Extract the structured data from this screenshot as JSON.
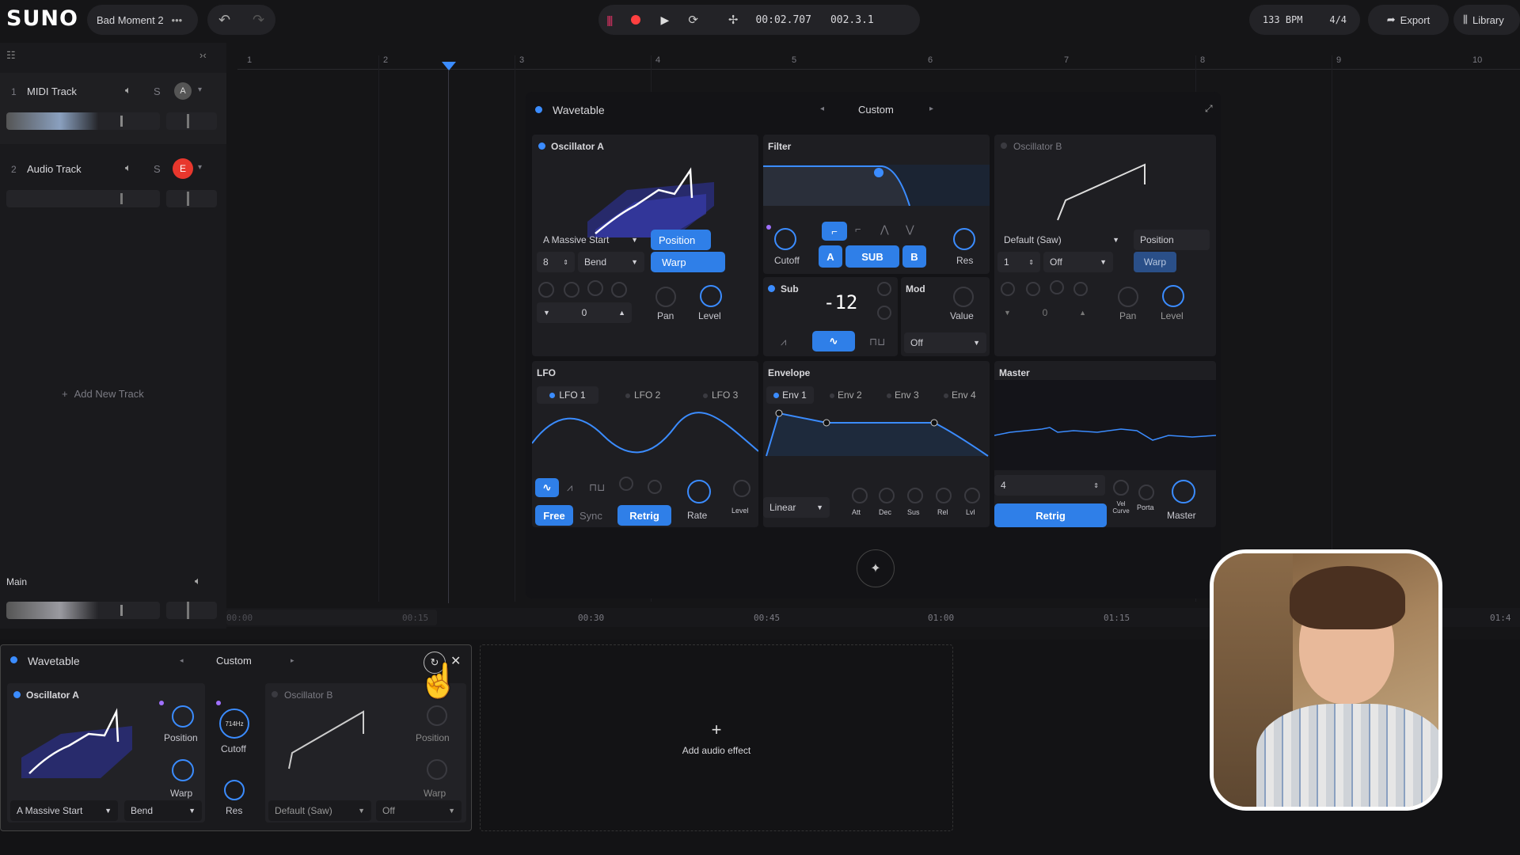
{
  "header": {
    "logo": "SUNO",
    "project": "Bad Moment 2",
    "time": "00:02.707",
    "position": "002.3.1",
    "bpm": "133 BPM",
    "meter": "4/4",
    "export": "Export",
    "library": "Library"
  },
  "tracks": [
    {
      "num": "1",
      "name": "MIDI Track",
      "solo": "S",
      "badge": "A"
    },
    {
      "num": "2",
      "name": "Audio Track",
      "solo": "S",
      "badge": "E"
    }
  ],
  "add_track": "Add New Track",
  "main_label": "Main",
  "ruler": [
    "1",
    "2",
    "3",
    "4",
    "5",
    "6",
    "7",
    "8",
    "9",
    "10"
  ],
  "timeline": [
    "00:00",
    "00:15",
    "00:30",
    "00:45",
    "01:00",
    "01:15",
    "01:4"
  ],
  "synth": {
    "title": "Wavetable",
    "preset": "Custom",
    "oscA": {
      "title": "Oscillator A",
      "wave": "A Massive Start",
      "position": "Position",
      "num": "8",
      "bend": "Bend",
      "warp": "Warp",
      "val": "0",
      "pan": "Pan",
      "level": "Level"
    },
    "filter": {
      "title": "Filter",
      "cutoff": "Cutoff",
      "res": "Res",
      "a": "A",
      "sub": "SUB",
      "b": "B"
    },
    "sub": {
      "title": "Sub",
      "value": "-12"
    },
    "mod": {
      "title": "Mod",
      "value": "Value",
      "off": "Off"
    },
    "oscB": {
      "title": "Oscillator B",
      "wave": "Default (Saw)",
      "position": "Position",
      "num": "1",
      "off": "Off",
      "warp": "Warp",
      "val": "0",
      "pan": "Pan",
      "level": "Level"
    },
    "lfo": {
      "title": "LFO",
      "tabs": [
        "LFO 1",
        "LFO 2",
        "LFO 3"
      ],
      "free": "Free",
      "sync": "Sync",
      "retrig": "Retrig",
      "rate": "Rate",
      "level": "Level"
    },
    "env": {
      "title": "Envelope",
      "tabs": [
        "Env 1",
        "Env 2",
        "Env 3",
        "Env 4"
      ],
      "mode": "Linear",
      "knobs": [
        "Att",
        "Dec",
        "Sus",
        "Rel",
        "Lvl"
      ]
    },
    "master": {
      "title": "Master",
      "num": "4",
      "retrig": "Retrig",
      "vel": "Vel Curve",
      "porta": "Porta",
      "master": "Master"
    }
  },
  "mini": {
    "title": "Wavetable",
    "preset": "Custom",
    "oscA": "Oscillator A",
    "position": "Position",
    "warp": "Warp",
    "cutoff": "Cutoff",
    "freq": "714Hz",
    "res": "Res",
    "oscB": "Oscillator B",
    "positionB": "Position",
    "warpB": "Warp",
    "waveA": "A Massive Start",
    "bend": "Bend",
    "waveB": "Default (Saw)",
    "off": "Off"
  },
  "add_effect": "Add audio effect",
  "colors": {
    "accent": "#3b8cff",
    "record": "#ff4040",
    "badge_e": "#e8372d"
  }
}
